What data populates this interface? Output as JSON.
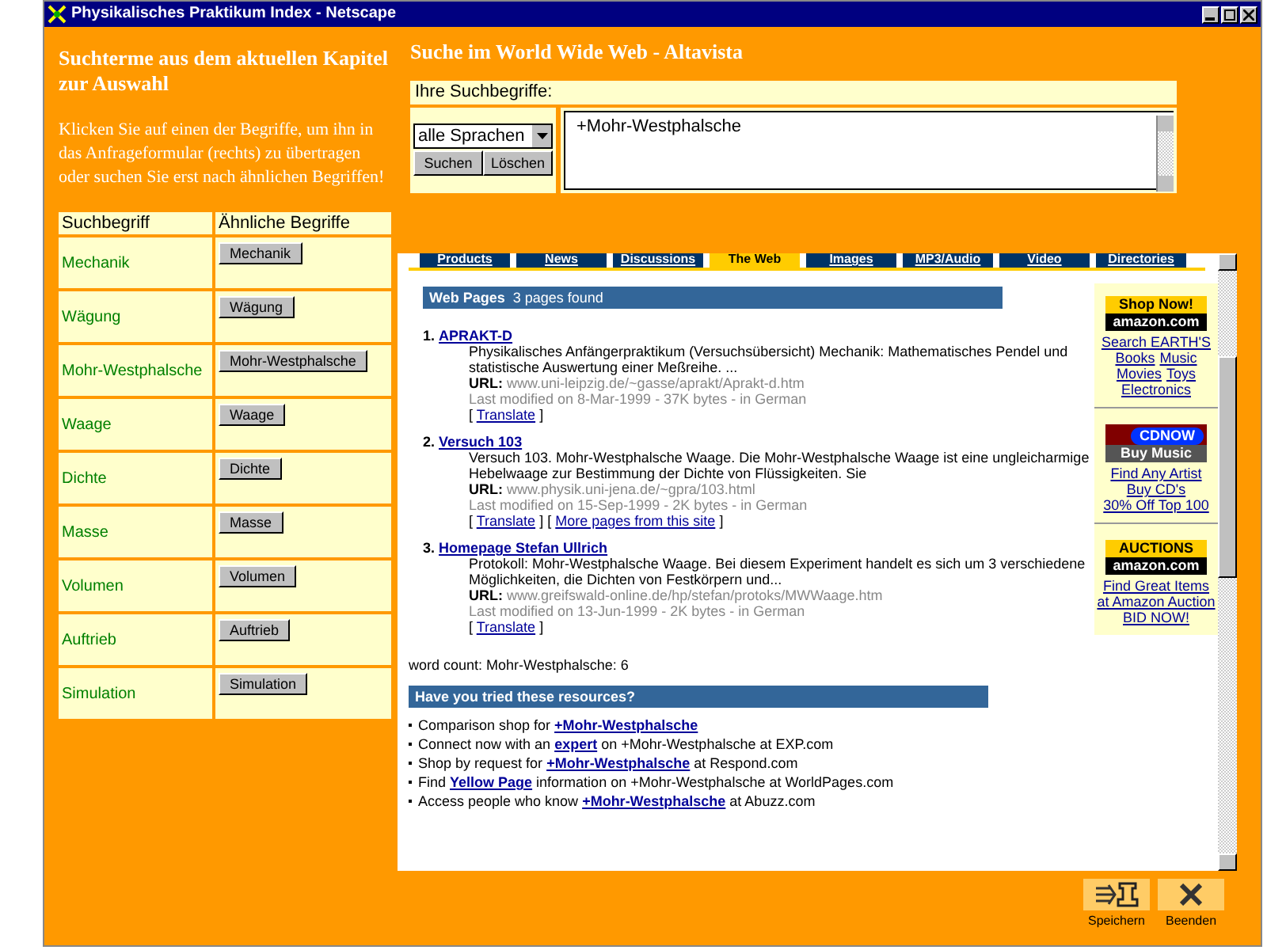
{
  "window": {
    "title": "Physikalisches Praktikum Index - Netscape"
  },
  "left": {
    "heading": "Suchterme aus dem aktuellen Kapitel zur Auswahl",
    "description": "Klicken Sie auf einen der Begriffe, um ihn in das Anfrageformular (rechts) zu übertragen oder suchen Sie erst nach ähnlichen Begriffen!",
    "table": {
      "columns": [
        "Suchbegriff",
        "Ähnliche Begriffe"
      ],
      "rows": [
        {
          "term": "Mechanik",
          "similar": "Mechanik"
        },
        {
          "term": "Wägung",
          "similar": "Wägung"
        },
        {
          "term": "Mohr-Westphalsche",
          "similar": "Mohr-Westphalsche"
        },
        {
          "term": "Waage",
          "similar": "Waage"
        },
        {
          "term": "Dichte",
          "similar": "Dichte"
        },
        {
          "term": "Masse",
          "similar": "Masse"
        },
        {
          "term": "Volumen",
          "similar": "Volumen"
        },
        {
          "term": "Auftrieb",
          "similar": "Auftrieb"
        },
        {
          "term": "Simulation",
          "similar": "Simulation"
        }
      ]
    }
  },
  "search": {
    "heading": "Suche im World Wide Web - Altavista",
    "label": "Ihre Suchbegriffe:",
    "language": "alle Sprachen",
    "buttons": [
      "Suchen",
      "Löschen"
    ],
    "query": "+Mohr-Westphalsche"
  },
  "results_frame": {
    "tabs": [
      {
        "label": "Products",
        "selected": false
      },
      {
        "label": "News",
        "selected": false
      },
      {
        "label": "Discussions",
        "selected": false
      },
      {
        "label": "The Web",
        "selected": true
      },
      {
        "label": "Images",
        "selected": false
      },
      {
        "label": "MP3/Audio",
        "selected": false
      },
      {
        "label": "Video",
        "selected": false
      },
      {
        "label": "Directories",
        "selected": false
      }
    ],
    "section": {
      "title": "Web Pages",
      "count": "3 pages found"
    },
    "link_brackets": [
      "[",
      "]"
    ],
    "results": [
      {
        "number": "1.",
        "title": "APRAKT-D",
        "snippet": "Physikalisches Anfängerpraktikum (Versuchsübersicht) Mechanik: Mathematisches Pendel und statistische Auswertung einer Meßreihe. ...",
        "url_label": "URL:",
        "url": "www.uni-leipzig.de/~gasse/aprakt/Aprakt-d.htm",
        "modified": "Last modified on 8-Mar-1999 - 37K bytes - in German",
        "links": [
          "Translate"
        ]
      },
      {
        "number": "2.",
        "title": "Versuch 103",
        "snippet": "Versuch 103. Mohr-Westphalsche Waage. Die Mohr-Westphalsche Waage ist eine ungleicharmige Hebelwaage zur Bestimmung der Dichte von Flüssigkeiten. Sie",
        "url_label": "URL:",
        "url": "www.physik.uni-jena.de/~gpra/103.html",
        "modified": "Last modified on 15-Sep-1999 - 2K bytes - in German",
        "links": [
          "Translate",
          "More pages from this site"
        ]
      },
      {
        "number": "3.",
        "title": "Homepage Stefan Ullrich",
        "snippet": "Protokoll: Mohr-Westphalsche Waage. Bei diesem Experiment handelt es sich um 3 verschiedene Möglichkeiten, die Dichten von Festkörpern und...",
        "url_label": "URL:",
        "url": "www.greifswald-online.de/hp/stefan/protoks/MWWaage.htm",
        "modified": "Last modified on 13-Jun-1999 - 2K bytes - in German",
        "links": [
          "Translate"
        ]
      }
    ],
    "word_count": "word count: Mohr-Westphalsche: 6",
    "resources_heading": "Have you tried these resources?",
    "resources": [
      {
        "before": "Comparison shop for ",
        "link": "+Mohr-Westphalsche"
      },
      {
        "before": "Connect now with an ",
        "link": "expert",
        "after": " on +Mohr-Westphalsche at EXP.com"
      },
      {
        "before": "Shop by request for ",
        "link": "+Mohr-Westphalsche",
        "after": " at Respond.com"
      },
      {
        "before": "Find ",
        "link": "Yellow Page",
        "after": " information on +Mohr-Westphalsche at WorldPages.com"
      },
      {
        "before": "Access people who know ",
        "link": "+Mohr-Westphalsche",
        "after": " at Abuzz.com"
      }
    ],
    "ads": [
      {
        "kind": "shop",
        "logo": [
          "Shop Now!",
          "amazon.com"
        ],
        "links": [
          "Search EARTH'S",
          "Books",
          "Music",
          "Movies",
          "Toys",
          "Electronics"
        ]
      },
      {
        "kind": "cdnow",
        "logo": [
          "CDNOW",
          "Buy Music"
        ],
        "links": [
          "Find Any Artist",
          "Buy CD's",
          "30% Off Top 100"
        ]
      },
      {
        "kind": "auctions",
        "logo": [
          "AUCTIONS",
          "amazon.com"
        ],
        "links": [
          "Find Great Items",
          "at Amazon Auction",
          "BID NOW!"
        ]
      }
    ]
  },
  "actions": [
    {
      "kind": "save",
      "label": "Speichern"
    },
    {
      "kind": "exit",
      "label": "Beenden"
    }
  ]
}
